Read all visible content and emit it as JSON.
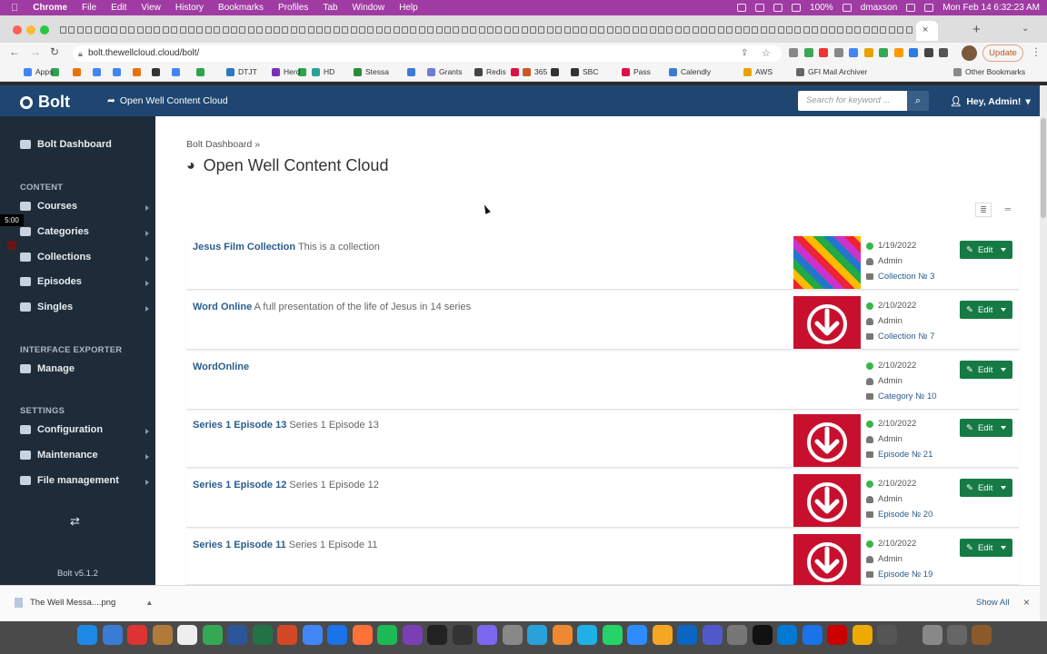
{
  "menubar": {
    "app": "Chrome",
    "items": [
      "File",
      "Edit",
      "View",
      "History",
      "Bookmarks",
      "Profiles",
      "Tab",
      "Window",
      "Help"
    ],
    "battery": "100%",
    "user": "dmaxson",
    "clock": "Mon Feb 14  6:32:23 AM"
  },
  "browser": {
    "url": "bolt.thewellcloud.cloud/bolt/",
    "update_label": "Update"
  },
  "bookmarks": {
    "items": [
      "Apps",
      "DTJT",
      "Herd",
      "HD",
      "Stessa",
      "Grants",
      "Redis",
      "365",
      "SBC",
      "Pass",
      "Calendly",
      "AWS",
      "GFI Mail Archiver"
    ],
    "other": "Other Bookmarks"
  },
  "header": {
    "brand": "Bolt",
    "site_link": "Open Well Content Cloud",
    "search_placeholder": "Search for keyword ...",
    "user": "Hey, Admin!"
  },
  "sidebar": {
    "dashboard": "Bolt Dashboard",
    "content_head": "CONTENT",
    "content_items": [
      "Courses",
      "Categories",
      "Collections",
      "Episodes",
      "Singles"
    ],
    "exporter_head": "INTERFACE EXPORTER",
    "exporter_items": [
      "Manage"
    ],
    "settings_head": "SETTINGS",
    "settings_items": [
      "Configuration",
      "Maintenance",
      "File management"
    ],
    "version": "Bolt v5.1.2",
    "timer": "5:00"
  },
  "main": {
    "breadcrumb": "Bolt Dashboard »",
    "title": "Open Well Content Cloud",
    "edit_label": "Edit",
    "records": [
      {
        "title": "Jesus Film Collection",
        "excerpt": "This is a collection",
        "date": "1/19/2022",
        "author": "Admin",
        "type": "Collection № 3",
        "thumb": "colorful"
      },
      {
        "title": "Word Online",
        "excerpt": "A full presentation of the life of Jesus in 14 series",
        "date": "2/10/2022",
        "author": "Admin",
        "type": "Collection № 7",
        "thumb": "download"
      },
      {
        "title": "WordOnline",
        "excerpt": "",
        "date": "2/10/2022",
        "author": "Admin",
        "type": "Category № 10",
        "thumb": "none"
      },
      {
        "title": "Series 1 Episode 13",
        "excerpt": "Series 1 Episode 13",
        "date": "2/10/2022",
        "author": "Admin",
        "type": "Episode № 21",
        "thumb": "download"
      },
      {
        "title": "Series 1 Episode 12",
        "excerpt": "Series 1 Episode 12",
        "date": "2/10/2022",
        "author": "Admin",
        "type": "Episode № 20",
        "thumb": "download"
      },
      {
        "title": "Series 1 Episode 11",
        "excerpt": "Series 1 Episode 11",
        "date": "2/10/2022",
        "author": "Admin",
        "type": "Episode № 19",
        "thumb": "download"
      }
    ]
  },
  "downloads": {
    "file": "The Well Messa....png",
    "show_all": "Show All"
  },
  "colors": {
    "header_bg": "#1f4670",
    "sidebar_bg": "#1e2b38",
    "edit_bg": "#167a45",
    "thumb_red": "#c8102e"
  }
}
